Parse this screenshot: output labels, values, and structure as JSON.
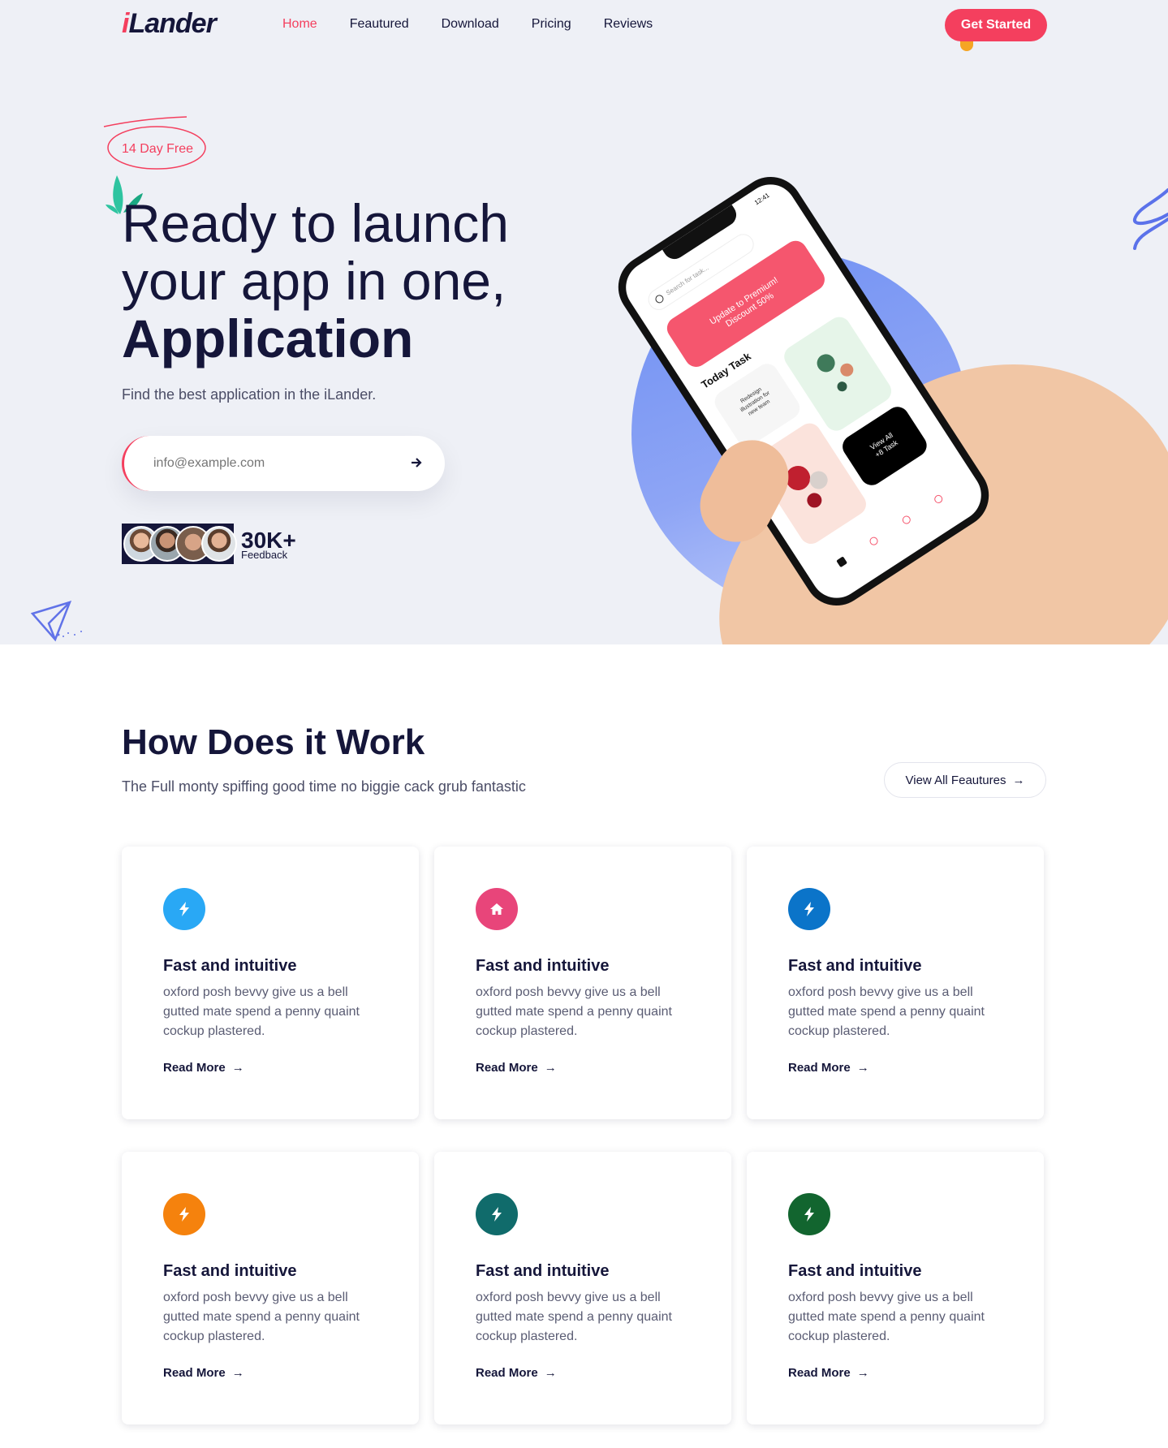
{
  "nav": {
    "logo_i": "i",
    "logo_rest": "Lander",
    "links": [
      "Home",
      "Feautured",
      "Download",
      "Pricing",
      "Reviews"
    ],
    "cta": "Get Started"
  },
  "hero": {
    "badge": "14 Day Free",
    "title_line1": "Ready to launch",
    "title_line2": "your app in one,",
    "title_line3": "Application",
    "subtitle": "Find the best application in the iLander.",
    "email_placeholder": "info@example.com",
    "feedback_count": "30K+",
    "feedback_label": "Feedback",
    "phone": {
      "time": "12:41",
      "search": "Search for task...",
      "promo_line1": "Update to Premium!",
      "promo_line2": "Discount 50%",
      "today": "Today Task",
      "task_line1": "Redesign",
      "task_line2": "illustration for",
      "task_line3": "new team",
      "view_all": "View All",
      "view_count": "+8 Task"
    }
  },
  "how": {
    "title": "How Does it Work",
    "subtitle": "The Full monty spiffing good time no biggie cack grub fantastic",
    "view_all": "View All Feautures"
  },
  "cards": [
    {
      "title": "Fast and intuitive",
      "text": "oxford posh bevvy give us a bell gutted mate spend a penny quaint cockup plastered.",
      "link": "Read More",
      "color": "#29a8f5",
      "icon": "bolt-icon"
    },
    {
      "title": "Fast and intuitive",
      "text": "oxford posh bevvy give us a bell gutted mate spend a penny quaint cockup plastered.",
      "link": "Read More",
      "color": "#e8457a",
      "icon": "home-icon"
    },
    {
      "title": "Fast and intuitive",
      "text": "oxford posh bevvy give us a bell gutted mate spend a penny quaint cockup plastered.",
      "link": "Read More",
      "color": "#0b74c9",
      "icon": "bolt-icon"
    },
    {
      "title": "Fast and intuitive",
      "text": "oxford posh bevvy give us a bell gutted mate spend a penny quaint cockup plastered.",
      "link": "Read More",
      "color": "#f5820d",
      "icon": "bolt-icon"
    },
    {
      "title": "Fast and intuitive",
      "text": "oxford posh bevvy give us a bell gutted mate spend a penny quaint cockup plastered.",
      "link": "Read More",
      "color": "#106b6b",
      "icon": "bolt-icon"
    },
    {
      "title": "Fast and intuitive",
      "text": "oxford posh bevvy give us a bell gutted mate spend a penny quaint cockup plastered.",
      "link": "Read More",
      "color": "#12652f",
      "icon": "bolt-icon"
    }
  ]
}
